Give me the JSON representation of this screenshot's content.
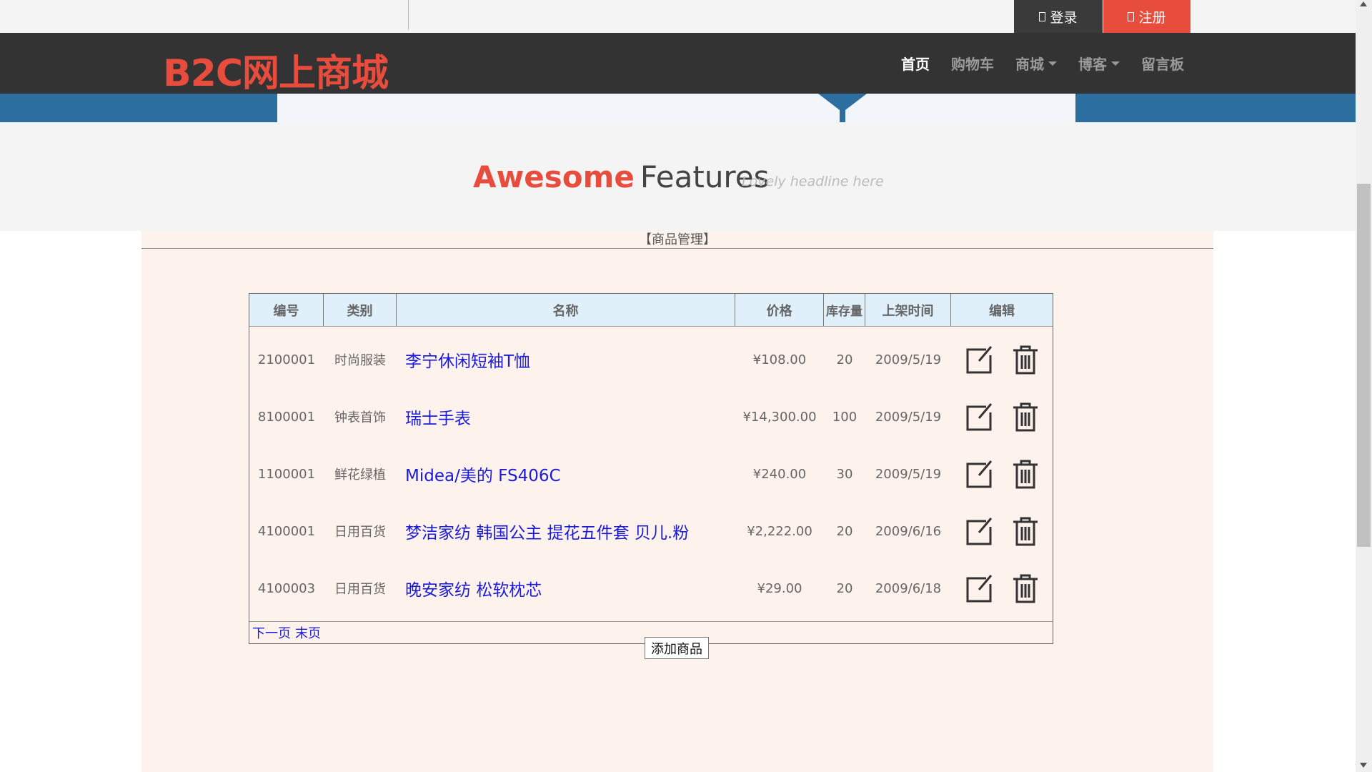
{
  "topbar": {
    "login_label": "登录",
    "register_label": "注册"
  },
  "header": {
    "logo": "B2C网上商城",
    "nav": [
      {
        "label": "首页",
        "active": true,
        "dropdown": false
      },
      {
        "label": "购物车",
        "active": false,
        "dropdown": false
      },
      {
        "label": "商城",
        "active": false,
        "dropdown": true
      },
      {
        "label": "博客",
        "active": false,
        "dropdown": true
      },
      {
        "label": "留言板",
        "active": false,
        "dropdown": false
      }
    ]
  },
  "features": {
    "title_highlight": "Awesome",
    "title_rest": "Features",
    "subtitle": "Lovely headline here"
  },
  "panel": {
    "title": "【商品管理】"
  },
  "table": {
    "headers": [
      "编号",
      "类别",
      "名称",
      "价格",
      "库存量",
      "上架时间",
      "编辑"
    ],
    "rows": [
      {
        "id": "2100001",
        "category": "时尚服装",
        "name": "李宁休闲短袖T恤",
        "price": "¥108.00",
        "stock": "20",
        "date": "2009/5/19"
      },
      {
        "id": "8100001",
        "category": "钟表首饰",
        "name": "瑞士手表",
        "price": "¥14,300.00",
        "stock": "100",
        "date": "2009/5/19"
      },
      {
        "id": "1100001",
        "category": "鲜花绿植",
        "name": "Midea/美的 FS406C",
        "price": "¥240.00",
        "stock": "30",
        "date": "2009/5/19"
      },
      {
        "id": "4100001",
        "category": "日用百货",
        "name": "梦洁家纺 韩国公主 提花五件套 贝儿.粉",
        "price": "¥2,222.00",
        "stock": "20",
        "date": "2009/6/16"
      },
      {
        "id": "4100003",
        "category": "日用百货",
        "name": "晚安家纺 松软枕芯",
        "price": "¥29.00",
        "stock": "20",
        "date": "2009/6/18"
      }
    ],
    "pager": {
      "next": "下一页",
      "last": "末页"
    }
  },
  "actions": {
    "add_label": "添加商品"
  },
  "colors": {
    "accent": "#e74c3c",
    "navbar": "#333333",
    "banner": "#2c6ea0",
    "panel": "#fdf2ec",
    "table_header": "#dff0fb",
    "link": "#1a1adb"
  }
}
